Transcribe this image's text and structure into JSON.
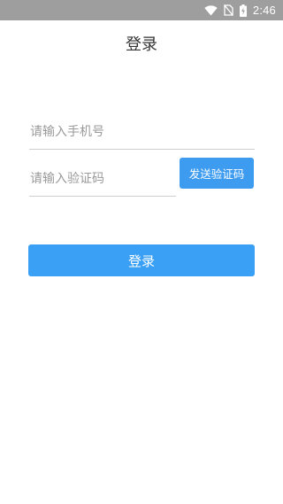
{
  "status_bar": {
    "time": "2:46",
    "icons": [
      "wifi-icon",
      "no-sim-icon",
      "battery-charging-icon"
    ]
  },
  "header": {
    "title": "登录"
  },
  "form": {
    "phone_placeholder": "请输入手机号",
    "code_placeholder": "请输入验证码",
    "send_code_label": "发送验证码",
    "login_label": "登录"
  },
  "colors": {
    "status_bar": "#9e9e9e",
    "primary_button": "#3aa0f5",
    "send_button": "#3d9bf0",
    "underline": "#cfcfcf",
    "placeholder": "#9a9a9a"
  }
}
